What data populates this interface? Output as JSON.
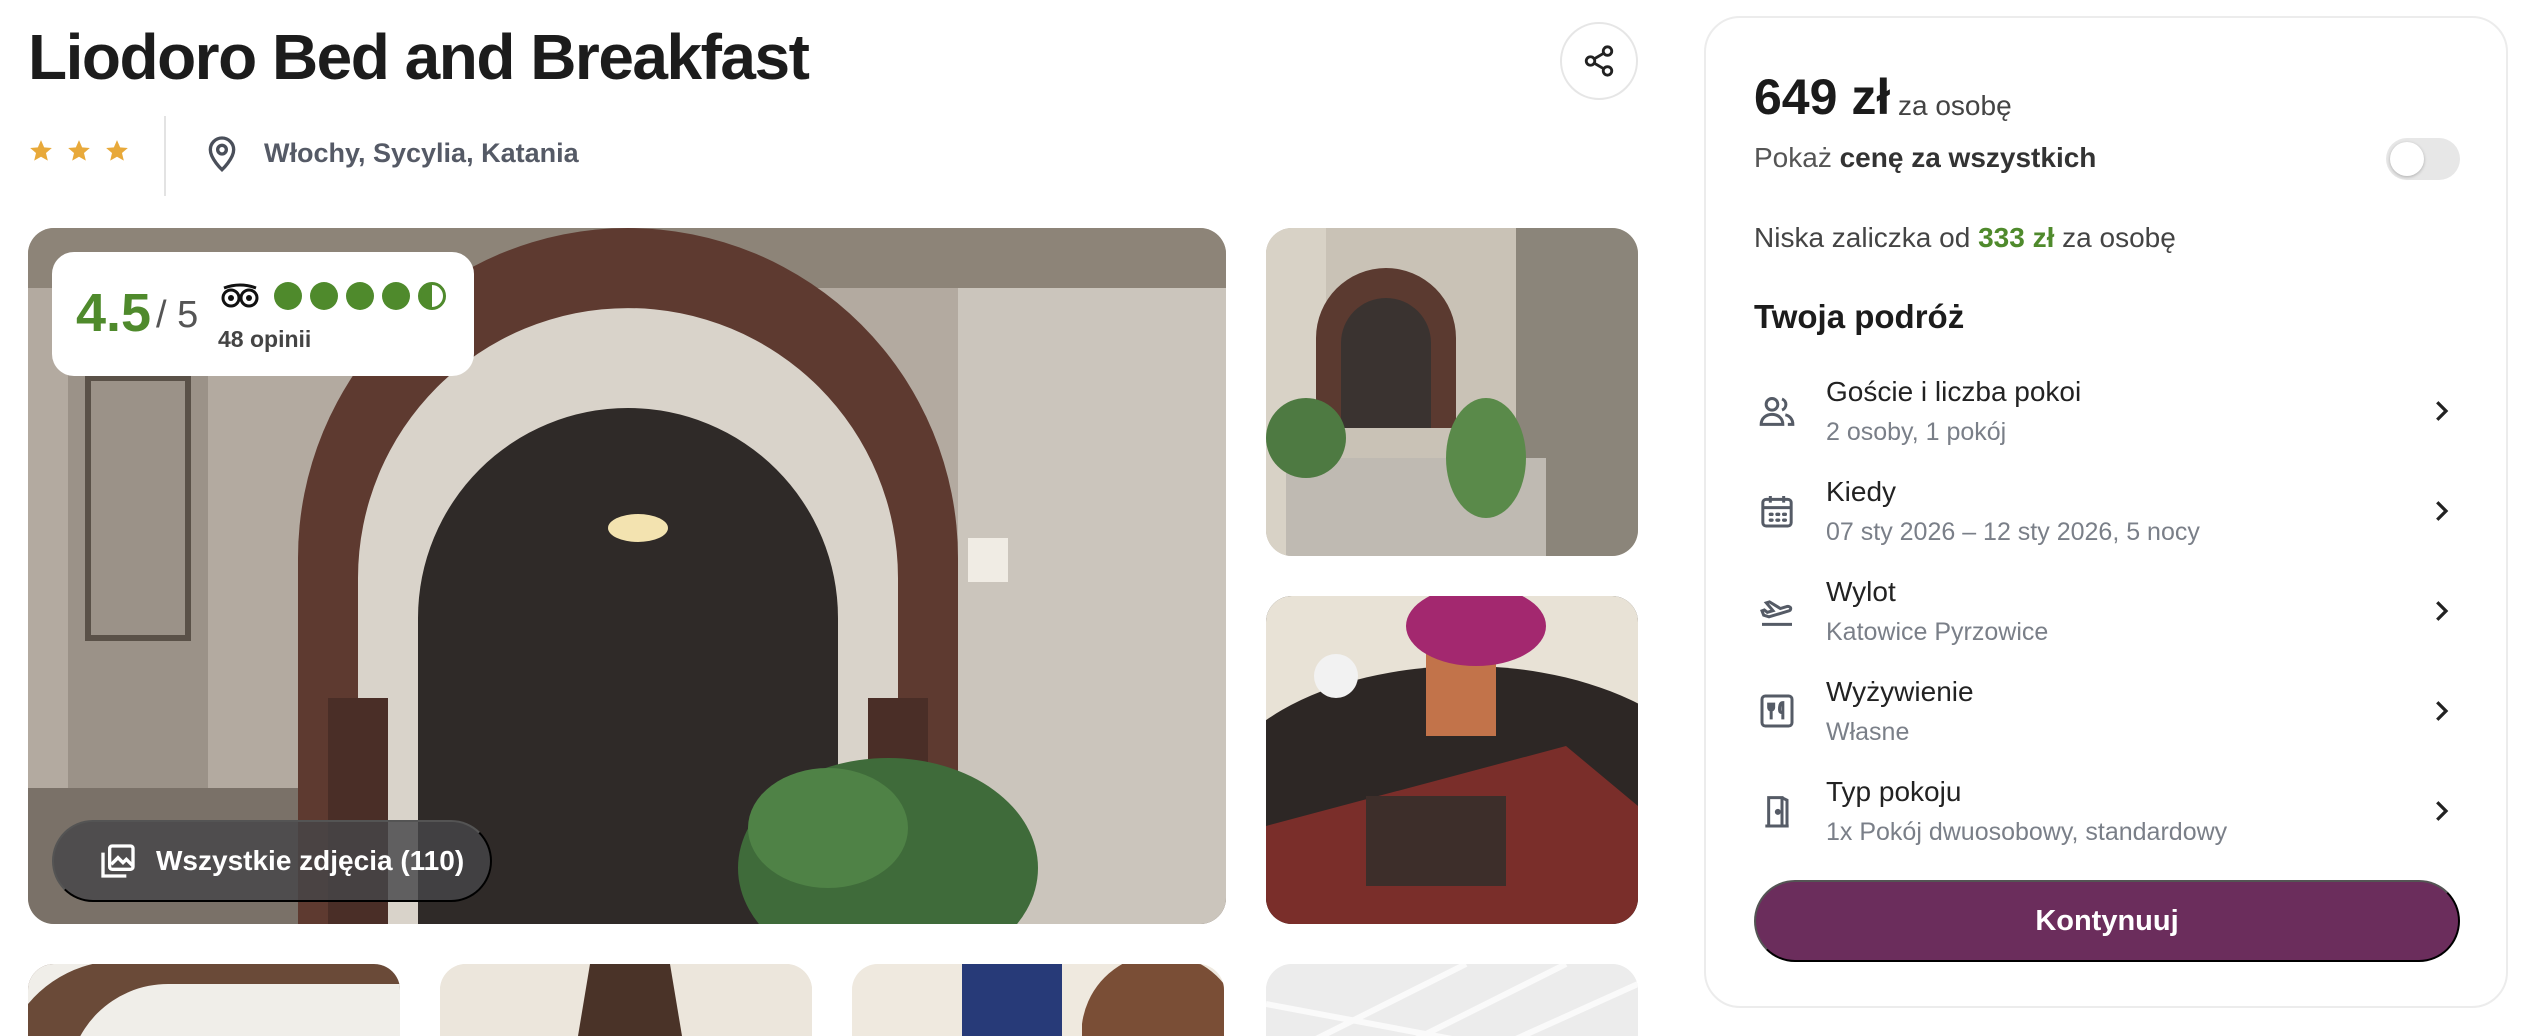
{
  "hotel": {
    "name": "Liodoro Bed and Breakfast",
    "stars": 3,
    "location": "Włochy, Sycylia, Katania"
  },
  "rating": {
    "score": "4.5",
    "max": "/ 5",
    "reviews": "48 opinii",
    "bubbles": 4.5
  },
  "gallery": {
    "all_photos_label": "Wszystkie zdjęcia (110)"
  },
  "booking": {
    "price": "649 zł",
    "price_unit": "za osobę",
    "show_all_prefix": "Pokaż ",
    "show_all_bold": "cenę za wszystkich",
    "toggle_on": false,
    "deposit_prefix": "Niska zaliczka od ",
    "deposit_amount": "333 zł",
    "deposit_suffix": " za osobę",
    "trip_heading": "Twoja podróż",
    "rows": [
      {
        "label": "Goście i liczba pokoi",
        "value": "2 osoby, 1 pokój",
        "icon": "guests-icon"
      },
      {
        "label": "Kiedy",
        "value": "07 sty 2026 – 12 sty 2026, 5 nocy",
        "icon": "calendar-icon"
      },
      {
        "label": "Wylot",
        "value": "Katowice Pyrzowice",
        "icon": "plane-departure-icon"
      },
      {
        "label": "Wyżywienie",
        "value": "Własne",
        "icon": "meal-icon"
      },
      {
        "label": "Typ pokoju",
        "value": "1x Pokój dwuosobowy, standardowy",
        "icon": "door-icon"
      }
    ],
    "cta": "Kontynuuj"
  },
  "colors": {
    "accent_green": "#4f8a2c",
    "cta_purple": "#6b2d5c",
    "star_gold": "#e8a93a"
  }
}
